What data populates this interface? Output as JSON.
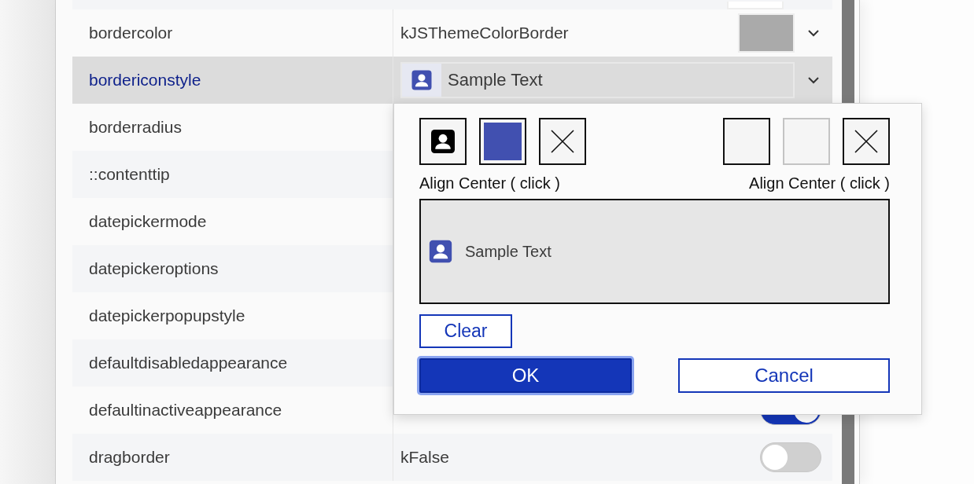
{
  "properties": [
    {
      "kind": "partial",
      "selected": false
    },
    {
      "name": "bordercolor",
      "kind": "color",
      "value": "kJSThemeColorBorder",
      "color": "#aaaaaa",
      "selected": false
    },
    {
      "name": "bordericonstyle",
      "kind": "icon_style",
      "value": "Sample Text",
      "selected": true
    },
    {
      "name": "borderradius",
      "kind": "text",
      "selected": false
    },
    {
      "name": "::contenttip",
      "kind": "text",
      "selected": false
    },
    {
      "name": "datepickermode",
      "kind": "text",
      "selected": false
    },
    {
      "name": "datepickeroptions",
      "kind": "text",
      "selected": false
    },
    {
      "name": "datepickerpopupstyle",
      "kind": "text",
      "selected": false
    },
    {
      "name": "defaultdisabledappearance",
      "kind": "text",
      "selected": false
    },
    {
      "name": "defaultinactiveappearance",
      "kind": "toggle",
      "on": true,
      "selected": false
    },
    {
      "name": "dragborder",
      "kind": "toggle",
      "value": "kFalse",
      "on": false,
      "selected": false
    }
  ],
  "popup": {
    "left_options": [
      {
        "kind": "icon"
      },
      {
        "kind": "color",
        "color": "#4150b0"
      },
      {
        "kind": "none"
      }
    ],
    "left_label": "Align Center ( click )",
    "right_options": [
      {
        "kind": "color",
        "color": "#f5f5f5"
      },
      {
        "kind": "blank"
      },
      {
        "kind": "none"
      }
    ],
    "right_label": "Align Center ( click )",
    "preview_text": "Sample Text",
    "clear_button": "Clear",
    "ok_button": "OK",
    "cancel_button": "Cancel"
  }
}
